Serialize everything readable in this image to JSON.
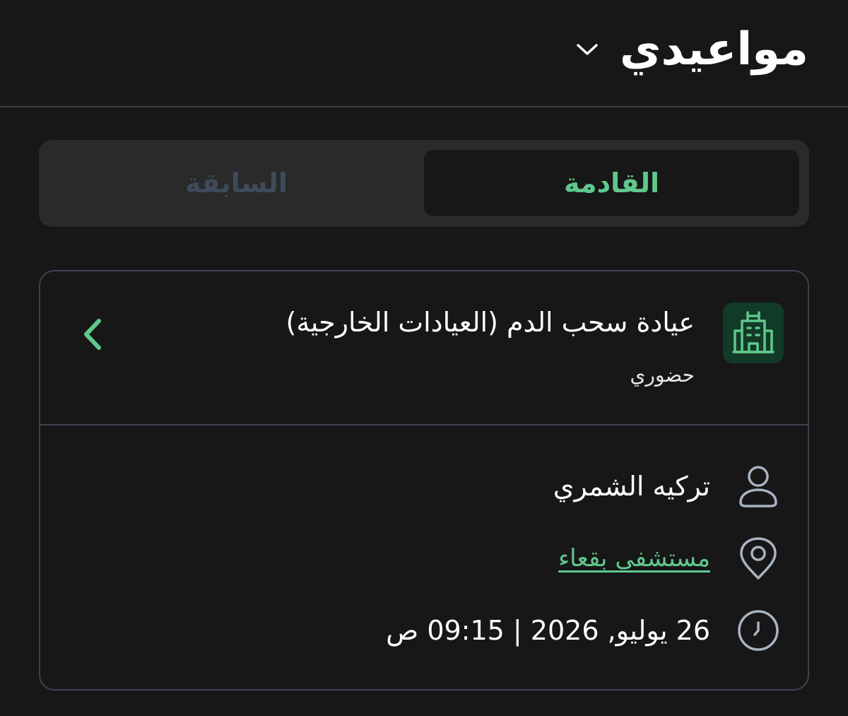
{
  "header": {
    "title": "مواعيدي",
    "dropdown_icon": "chevron-down-icon"
  },
  "tabs": {
    "upcoming_label": "القادمة",
    "past_label": "السابقة",
    "selected": "upcoming"
  },
  "appointment": {
    "clinic_icon": "hospital-building-icon",
    "clinic_name": "عيادة سحب الدم (العيادات الخارجية)",
    "visit_type": "حضوري",
    "open_icon": "chevron-left-icon",
    "doctor_icon": "person-icon",
    "doctor_name": "تركيه الشمري",
    "location_icon": "location-pin-icon",
    "location_name": "مستشفى بقعاء",
    "time_icon": "clock-icon",
    "datetime": "26 يوليو, 2026 | 09:15 ص"
  },
  "colors": {
    "background": "#171717",
    "accent_green": "#5fc88c",
    "muted_tab_text": "#3f4a5a",
    "divider": "#3c4350",
    "icon_gray": "#a9b4c2"
  }
}
